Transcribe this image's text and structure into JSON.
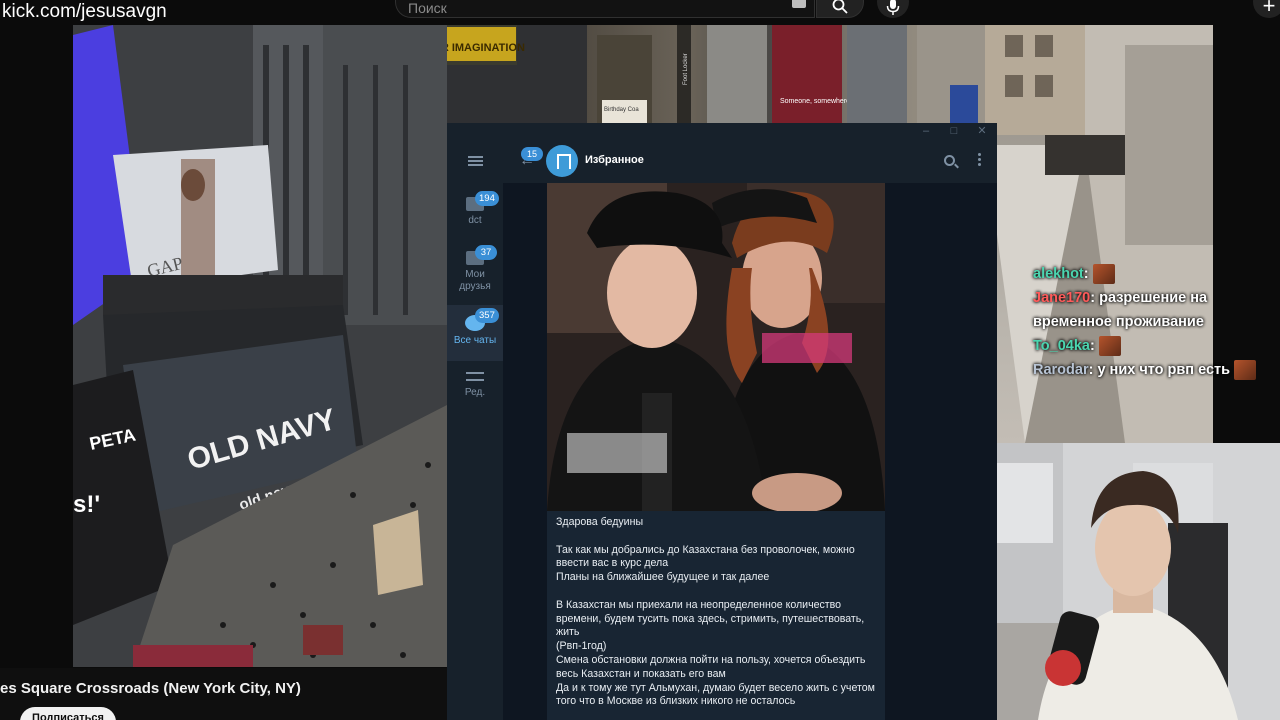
{
  "browser": {
    "url": "kick.com/jesusavgn",
    "search_placeholder": "Поиск"
  },
  "video": {
    "title": "es Square Crossroads (New York City, NY)",
    "subscribe_label": "Подписаться"
  },
  "scene": {
    "billboards": [
      "GAP",
      "OLD NAVY",
      "old navy",
      "PETA",
      "s!'"
    ],
    "top_billboard": "YOUR IMAGINATION",
    "ads": [
      "Someone, somewhere loves a good",
      "Birthday Coa",
      "Foot Locker"
    ]
  },
  "stream_chat": [
    {
      "user": "alekhot",
      "user_color": "#4bd6b0",
      "text": "",
      "emote": true
    },
    {
      "user": "Jane170",
      "user_color": "#ff5a5a",
      "text": "разрешение на временное проживание",
      "emote": false
    },
    {
      "user": "To_04ka",
      "user_color": "#4bd6b0",
      "text": "",
      "emote": true
    },
    {
      "user": "Rarodar",
      "user_color": "#b8c4d4",
      "text": "у них что рвп есть",
      "emote": true
    }
  ],
  "telegram": {
    "menu_icon": "hamburger",
    "folders": [
      {
        "label": "dct",
        "badge": "194",
        "active": false,
        "icon": "folder-icon"
      },
      {
        "label": "Мои друзья",
        "badge": "37",
        "active": false,
        "icon": "folder-icon"
      },
      {
        "label": "Все чаты",
        "badge": "357",
        "active": true,
        "icon": "chats-icon"
      },
      {
        "label": "Ред.",
        "badge": "",
        "active": false,
        "icon": "edit-icon"
      }
    ],
    "header": {
      "back_badge": "15",
      "title": "Избранное"
    },
    "message": {
      "lines": [
        "Здарова бедуины",
        "",
        "Так как мы добрались до Казахстана без проволочек, можно",
        "ввести вас в курс дела",
        "Планы на ближайшее будущее и так далее",
        "",
        "В Казахстан мы приехали на неопределенное количество",
        "времени, будем тусить пока здесь, стримить, путешествовать,",
        "жить",
        "(Рвп-1год)",
        "Смена обстановки должна пойти на пользу, хочется объездить",
        "весь Казахстан и показать его вам",
        "Да и к тому же тут Альмухан, думаю будет весело жить с учетом",
        "того что в Москве из близких никого не осталось"
      ]
    }
  }
}
